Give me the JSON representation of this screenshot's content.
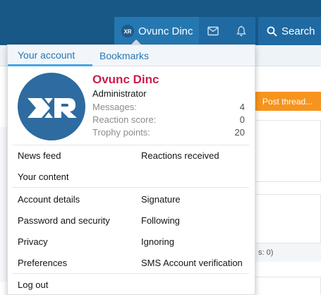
{
  "header": {
    "account_name": "Ovunc Dinc",
    "search_label": "Search",
    "icons": [
      "avatar-small",
      "mail-icon",
      "bell-icon",
      "search-icon"
    ]
  },
  "background": {
    "post_thread_label": "Post thread...",
    "card_footer_text": "s: 0)"
  },
  "menu": {
    "tabs": [
      {
        "label": "Your account"
      },
      {
        "label": "Bookmarks"
      }
    ],
    "profile": {
      "name": "Ovunc Dinc",
      "role": "Administrator",
      "stats": [
        {
          "label": "Messages:",
          "value": "4"
        },
        {
          "label": "Reaction score:",
          "value": "0"
        },
        {
          "label": "Trophy points:",
          "value": "20"
        }
      ]
    },
    "links_group1": {
      "news_feed": "News feed",
      "reactions_received": "Reactions received",
      "your_content": "Your content"
    },
    "links_group2": {
      "account_details": "Account details",
      "signature": "Signature",
      "password_security": "Password and security",
      "following": "Following",
      "privacy": "Privacy",
      "ignoring": "Ignoring",
      "preferences": "Preferences",
      "sms_verification": "SMS Account verification"
    },
    "logout": "Log out"
  },
  "colors": {
    "header_bg": "#185886",
    "account_tab_bg": "#2577b1",
    "username_color": "#cc1e4b",
    "post_button": "#f7941d",
    "link_blue": "#2577b1"
  }
}
